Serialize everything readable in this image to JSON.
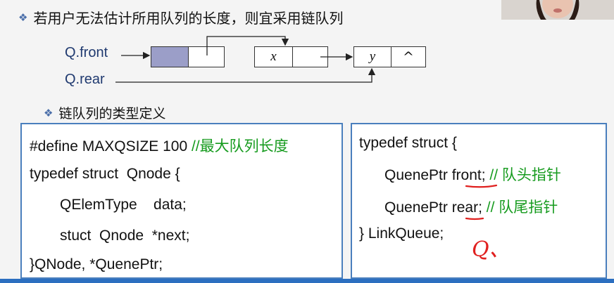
{
  "slide": {
    "heading": "若用户无法估计所用队列的长度，则宜采用链队列",
    "subheading": "链队列的类型定义",
    "diagram": {
      "front_label": "Q.front",
      "rear_label": "Q.rear",
      "node2_data": "x",
      "node3_data": "y",
      "null_symbol": "^"
    },
    "left_code": {
      "line1_code": "#define MAXQSIZE 100 ",
      "line1_comment": "//最大队列长度",
      "line2": "typedef struct  Qnode {",
      "line3": "QElemType    data;",
      "line4": "stuct  Qnode  *next;",
      "line5": "}QNode, *QuenePtr;"
    },
    "right_code": {
      "line1": "typedef struct {",
      "line2_code": "QuenePtr front;",
      "line2_comment": " // 队头指针",
      "line3_code": "QuenePtr rear;",
      "line3_comment": " // 队尾指针",
      "line4": "} LinkQueue;"
    },
    "annotation": "Q、"
  },
  "colors": {
    "accent": "#4a7fbd",
    "comment": "#169b1e",
    "head_node_fill": "#9b9ec8",
    "annotation": "#e0201f"
  }
}
